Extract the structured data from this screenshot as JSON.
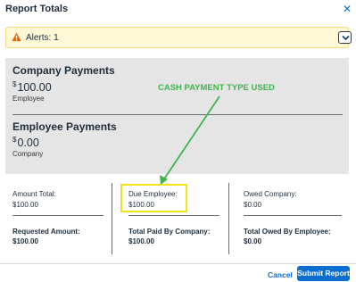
{
  "dialog": {
    "title": "Report Totals"
  },
  "alerts": {
    "label": "Alerts: 1"
  },
  "company_payments": {
    "title": "Company Payments",
    "currency": "$",
    "amount": "100.00",
    "sub": "Employee"
  },
  "employee_payments": {
    "title": "Employee Payments",
    "currency": "$",
    "amount": "0.00",
    "sub": "Company"
  },
  "annotation": {
    "text": "CASH PAYMENT TYPE USED",
    "color": "#3fb44c",
    "highlight_color": "#f2e21a"
  },
  "summary": {
    "col1": {
      "label": "Amount Total:",
      "value": "$100.00",
      "bold_label": "Requested Amount:",
      "bold_value": "$100.00"
    },
    "col2": {
      "label": "Due Employee:",
      "value": "$100.00",
      "bold_label": "Total Paid By Company:",
      "bold_value": "$100.00"
    },
    "col3": {
      "label": "Owed Company:",
      "value": "$0.00",
      "bold_label": "Total Owed By Employee:",
      "bold_value": "$0.00"
    }
  },
  "footer": {
    "cancel_label": "Cancel",
    "submit_label": "Submit Report"
  },
  "colors": {
    "accent": "#0a6ed1",
    "alert_bg": "#fff8d6",
    "panel_bg": "#e5e5e5"
  },
  "icons": {
    "close": "close-icon",
    "alert": "warning-icon",
    "toggle": "chevron-down-icon"
  }
}
